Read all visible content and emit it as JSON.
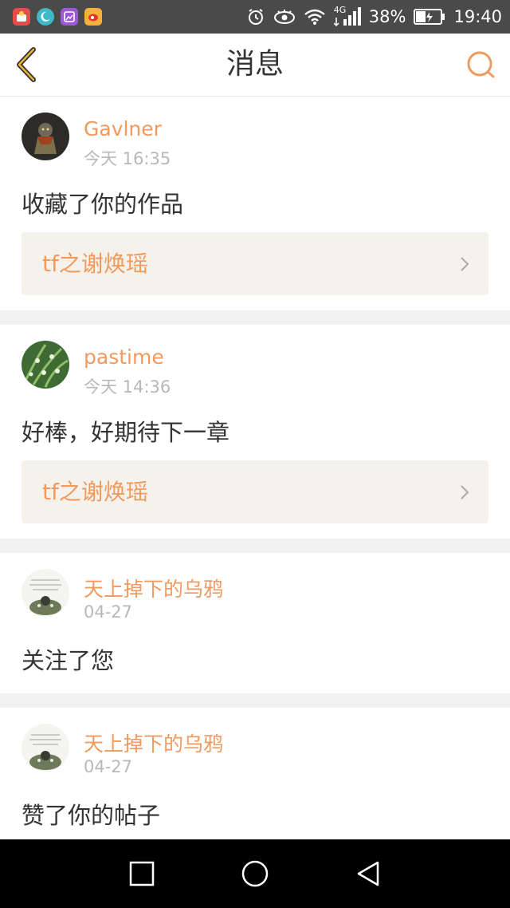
{
  "status_bar": {
    "battery": "38%",
    "time": "19:40",
    "network": "4G"
  },
  "header": {
    "title": "消息"
  },
  "messages": [
    {
      "user": "Gavlner",
      "time": "今天 16:35",
      "text": "收藏了你的作品",
      "ref": "tf之谢焕瑶"
    },
    {
      "user": "pastime",
      "time": "今天 14:36",
      "text": "好棒，好期待下一章",
      "ref": "tf之谢焕瑶"
    },
    {
      "user": "天上掉下的乌鸦",
      "time": "04-27",
      "text": "关注了您"
    },
    {
      "user": "天上掉下的乌鸦",
      "time": "04-27",
      "text": "赞了你的帖子"
    }
  ],
  "colors": {
    "accent": "#f09a5f",
    "ref_bg": "#f4f2ea",
    "status_bar": "#4a4a4a"
  },
  "icons": {
    "back": "chevron-left-icon",
    "search": "search-icon",
    "nav_recent": "square-icon",
    "nav_home": "circle-icon",
    "nav_back": "triangle-back-icon"
  }
}
